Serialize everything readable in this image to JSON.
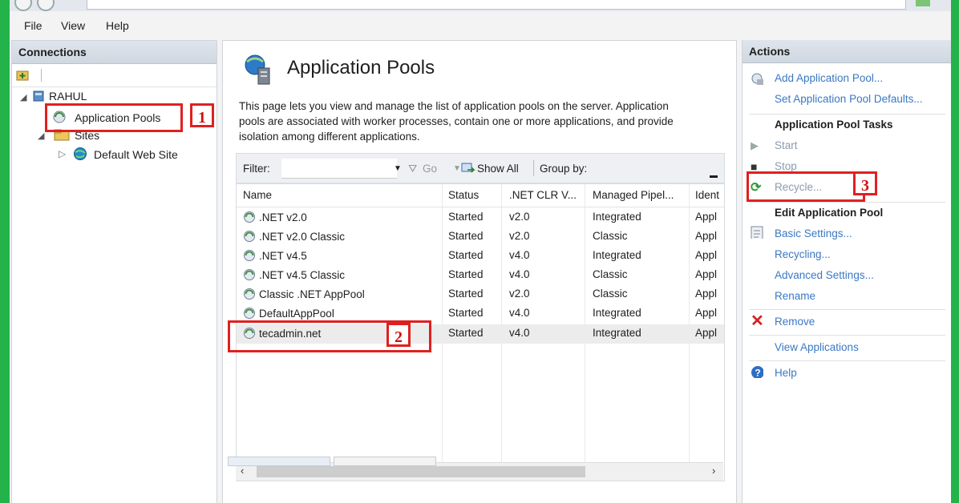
{
  "menu": {
    "file": "File",
    "view": "View",
    "help": "Help"
  },
  "connections": {
    "title": "Connections",
    "server": "RAHUL",
    "app_pools": "Application Pools",
    "sites": "Sites",
    "default_site": "Default Web Site"
  },
  "main": {
    "title": "Application Pools",
    "description": "This page lets you view and manage the list of application pools on the server. Application pools are associated with worker processes, contain one or more applications, and provide isolation among different applications.",
    "filter_label": "Filter:",
    "filter_value": "",
    "go_label": "Go",
    "show_all_label": "Show All",
    "group_by_label": "Group by:",
    "columns": [
      "Name",
      "Status",
      ".NET CLR V...",
      "Managed Pipel...",
      "Ident"
    ],
    "rows": [
      {
        "name": ".NET v2.0",
        "status": "Started",
        "clr": "v2.0",
        "pipeline": "Integrated",
        "identity": "Appl"
      },
      {
        "name": ".NET v2.0 Classic",
        "status": "Started",
        "clr": "v2.0",
        "pipeline": "Classic",
        "identity": "Appl"
      },
      {
        "name": ".NET v4.5",
        "status": "Started",
        "clr": "v4.0",
        "pipeline": "Integrated",
        "identity": "Appl"
      },
      {
        "name": ".NET v4.5 Classic",
        "status": "Started",
        "clr": "v4.0",
        "pipeline": "Classic",
        "identity": "Appl"
      },
      {
        "name": "Classic .NET AppPool",
        "status": "Started",
        "clr": "v2.0",
        "pipeline": "Classic",
        "identity": "Appl"
      },
      {
        "name": "DefaultAppPool",
        "status": "Started",
        "clr": "v4.0",
        "pipeline": "Integrated",
        "identity": "Appl"
      },
      {
        "name": "tecadmin.net",
        "status": "Started",
        "clr": "v4.0",
        "pipeline": "Integrated",
        "identity": "Appl"
      }
    ]
  },
  "actions": {
    "title": "Actions",
    "add_pool": "Add Application Pool...",
    "set_defaults": "Set Application Pool Defaults...",
    "tasks_heading": "Application Pool Tasks",
    "start": "Start",
    "stop": "Stop",
    "recycle": "Recycle...",
    "edit_heading": "Edit Application Pool",
    "basic_settings": "Basic Settings...",
    "recycling": "Recycling...",
    "advanced_settings": "Advanced Settings...",
    "rename": "Rename",
    "remove": "Remove",
    "view_apps": "View Applications",
    "help": "Help"
  },
  "annotations": {
    "step1": "1",
    "step2": "2",
    "step3": "3"
  },
  "colors": {
    "annotation_red": "#e02020",
    "link_blue": "#3a78c4",
    "frame_green": "#23b34a"
  }
}
